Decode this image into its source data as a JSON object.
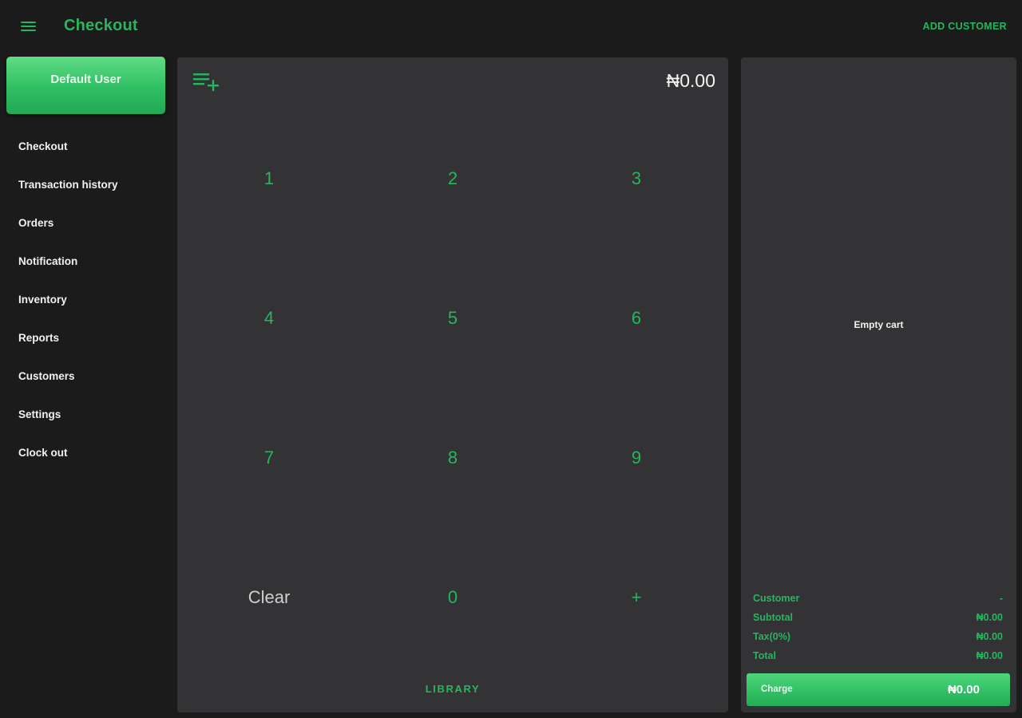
{
  "header": {
    "title": "Checkout",
    "add_customer_label": "ADD CUSTOMER",
    "menu_icon": "hamburger-menu-icon"
  },
  "sidebar": {
    "user_button_label": "Default User",
    "items": [
      {
        "label": "Checkout"
      },
      {
        "label": "Transaction history"
      },
      {
        "label": "Orders"
      },
      {
        "label": "Notification"
      },
      {
        "label": "Inventory"
      },
      {
        "label": "Reports"
      },
      {
        "label": "Customers"
      },
      {
        "label": "Settings"
      },
      {
        "label": "Clock out"
      }
    ]
  },
  "keypad": {
    "add_icon": "playlist-add-icon",
    "amount": "₦0.00",
    "keys": [
      "1",
      "2",
      "3",
      "4",
      "5",
      "6",
      "7",
      "8",
      "9",
      "Clear",
      "0",
      "+"
    ],
    "library_label": "LIBRARY"
  },
  "cart": {
    "empty_label": "Empty cart",
    "summary": [
      {
        "label": "Customer",
        "value": "-"
      },
      {
        "label": "Subtotal",
        "value": "₦0.00"
      },
      {
        "label": "Tax(0%)",
        "value": "₦0.00"
      },
      {
        "label": "Total",
        "value": "₦0.00"
      }
    ],
    "charge_label": "Charge",
    "charge_amount": "₦0.00"
  },
  "colors": {
    "accent": "#27b55e",
    "background": "#1b1b1b",
    "panel": "#333335"
  }
}
